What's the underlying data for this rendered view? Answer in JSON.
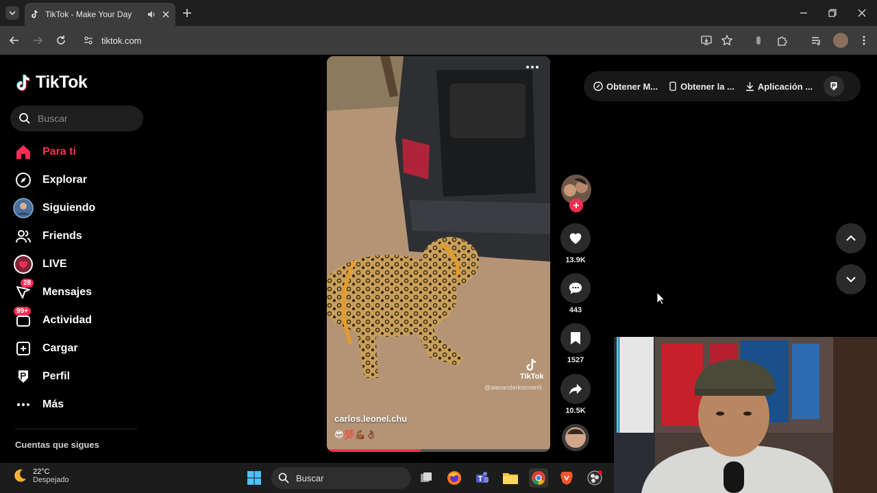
{
  "browser": {
    "tab_title": "TikTok - Make Your Day",
    "url": "tiktok.com"
  },
  "tiktok": {
    "logo": "TikTok",
    "search_placeholder": "Buscar",
    "nav": [
      {
        "label": "Para ti",
        "icon": "home-icon",
        "active": true
      },
      {
        "label": "Explorar",
        "icon": "compass-icon"
      },
      {
        "label": "Siguiendo",
        "icon": "following-avatar-icon"
      },
      {
        "label": "Friends",
        "icon": "friends-icon"
      },
      {
        "label": "LIVE",
        "icon": "live-icon"
      },
      {
        "label": "Mensajes",
        "icon": "messages-icon",
        "badge": "28"
      },
      {
        "label": "Actividad",
        "icon": "activity-icon",
        "badge": "99+"
      },
      {
        "label": "Cargar",
        "icon": "upload-icon"
      },
      {
        "label": "Perfil",
        "icon": "profile-icon"
      },
      {
        "label": "Más",
        "icon": "more-icon"
      }
    ],
    "following_heading": "Cuentas que sigues",
    "top_actions": [
      "Obtener M...",
      "Obtener la ...",
      "Aplicación ..."
    ],
    "video": {
      "username": "carlos.leonel.chu",
      "caption": "😎💯💪🏾👌🏾",
      "watermark": "TikTok",
      "watermark_user": "@alexanderkremen5",
      "progress": 0.42
    },
    "actions": {
      "likes": "13.9K",
      "comments": "443",
      "saves": "1527",
      "shares": "10.5K"
    }
  },
  "taskbar": {
    "temperature": "22°C",
    "weather": "Despejado",
    "search_placeholder": "Buscar"
  },
  "colors": {
    "accent": "#fe2c55",
    "background": "#000000"
  }
}
